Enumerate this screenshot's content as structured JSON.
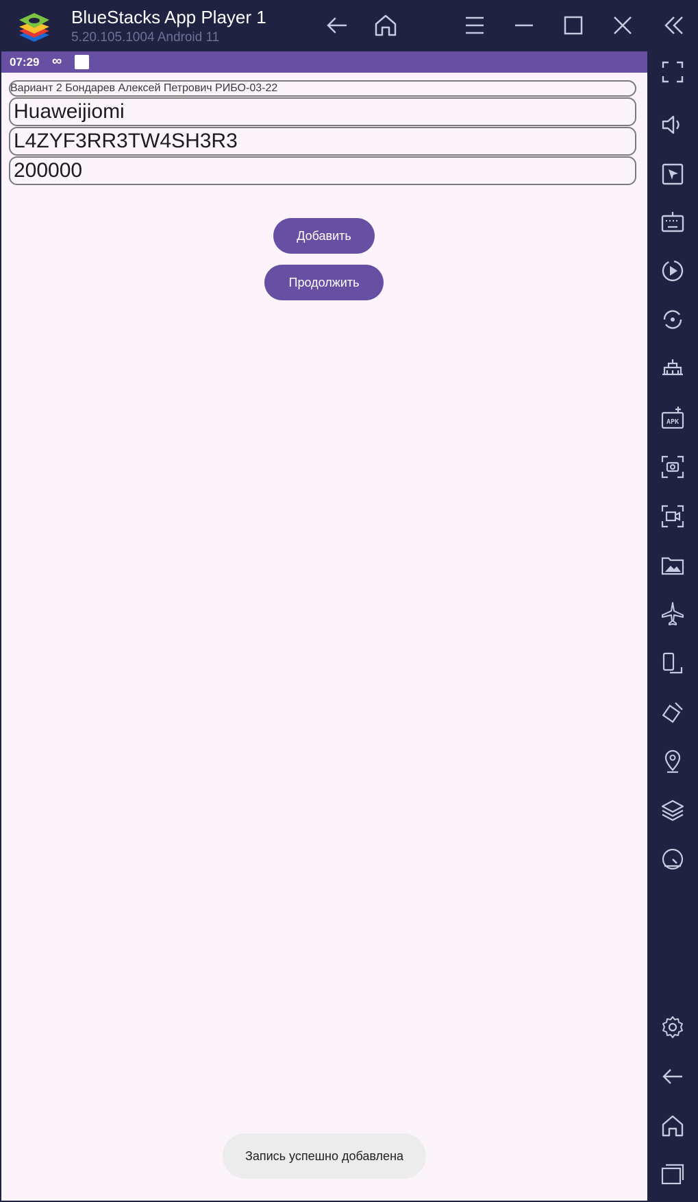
{
  "window": {
    "title": "BlueStacks App Player 1",
    "version": "5.20.105.1004  Android 11",
    "controls": [
      "back-icon",
      "home-icon",
      "menu-icon",
      "minimize-icon",
      "maximize-icon",
      "close-icon",
      "collapse-sidebar-icon"
    ]
  },
  "statusbar": {
    "time": "07:29",
    "infinity": "∞"
  },
  "form": {
    "header": "Вариант 2 Бондарев Алексей Петрович РИБО-03-22",
    "field1": "Huaweijiomi",
    "field2": "L4ZYF3RR3TW4SH3R3",
    "field3": "200000"
  },
  "buttons": {
    "add": "Добавить",
    "continue": "Продолжить"
  },
  "toast": "Запись успешно добавлена",
  "sidebar": {
    "items": [
      "fullscreen-icon",
      "volume-icon",
      "pointer-icon",
      "keyboard-icon",
      "macro-icon",
      "rotate-sync-icon",
      "build-icon",
      "apk-icon",
      "screenshot-icon",
      "record-icon",
      "gallery-icon",
      "airplane-icon",
      "device-icon",
      "eco-icon",
      "location-icon",
      "layers-icon",
      "performance-icon",
      "settings-icon",
      "android-back-icon",
      "android-home-icon",
      "recents-icon"
    ]
  },
  "colors": {
    "chrome": "#1f2240",
    "accent": "#6750a4",
    "screen_bg": "#fcf4fb"
  }
}
